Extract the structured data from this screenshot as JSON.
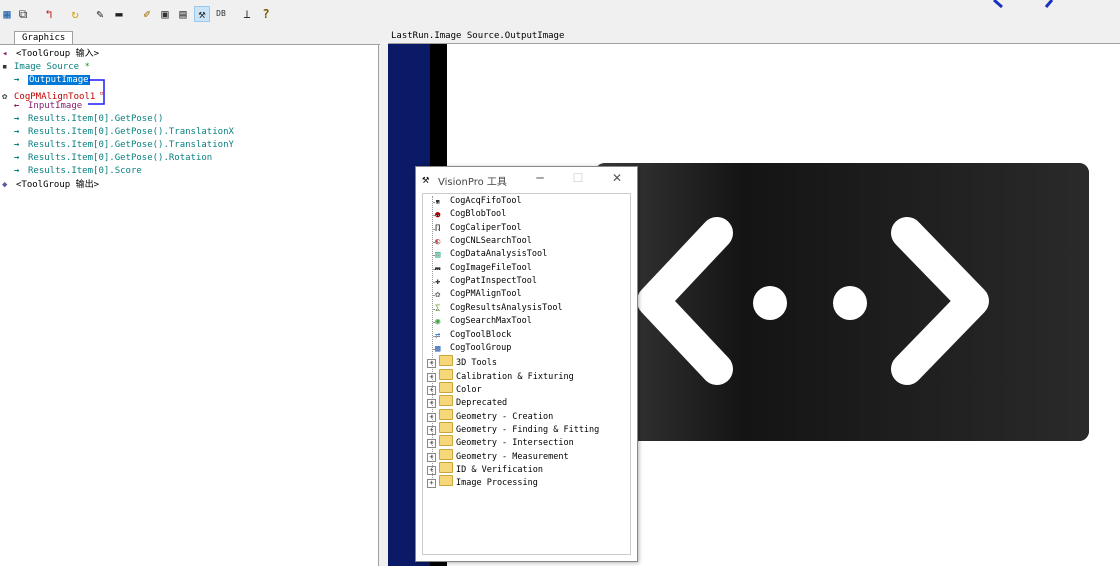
{
  "toolbar": {
    "icons": [
      "image-grid-icon",
      "add-tool-icon",
      "back-arrow-icon",
      "refresh-icon",
      "pen-icon",
      "record-icon",
      "edit-icon",
      "image-icon",
      "image-panel-icon",
      "tools-icon",
      "dbs-icon",
      "chart-icon",
      "help-icon"
    ]
  },
  "left_panel": {
    "tab": "Graphics",
    "tree": [
      {
        "label": "<ToolGroup 输入>"
      },
      {
        "label": "Image Source"
      },
      {
        "label": "OutputImage"
      },
      {
        "label": "CogPMAlignTool1"
      },
      {
        "label": "InputImage"
      },
      {
        "label": "Results.Item[0].GetPose()"
      },
      {
        "label": "Results.Item[0].GetPose().TranslationX"
      },
      {
        "label": "Results.Item[0].GetPose().TranslationY"
      },
      {
        "label": "Results.Item[0].GetPose().Rotation"
      },
      {
        "label": "Results.Item[0].Score"
      },
      {
        "label": "<ToolGroup 输出>"
      }
    ]
  },
  "right_panel": {
    "header": "LastRun.Image Source.OutputImage"
  },
  "popup": {
    "title": "VisionPro 工具",
    "tools": [
      "CogAcqFifoTool",
      "CogBlobTool",
      "CogCaliperTool",
      "CogCNLSearchTool",
      "CogDataAnalysisTool",
      "CogImageFileTool",
      "CogPatInspectTool",
      "CogPMAlignTool",
      "CogResultsAnalysisTool",
      "CogSearchMaxTool",
      "CogToolBlock",
      "CogToolGroup"
    ],
    "folders": [
      "3D Tools",
      "Calibration & Fixturing",
      "Color",
      "Deprecated",
      "Geometry - Creation",
      "Geometry - Finding & Fitting",
      "Geometry - Intersection",
      "Geometry - Measurement",
      "ID & Verification",
      "Image Processing"
    ]
  }
}
